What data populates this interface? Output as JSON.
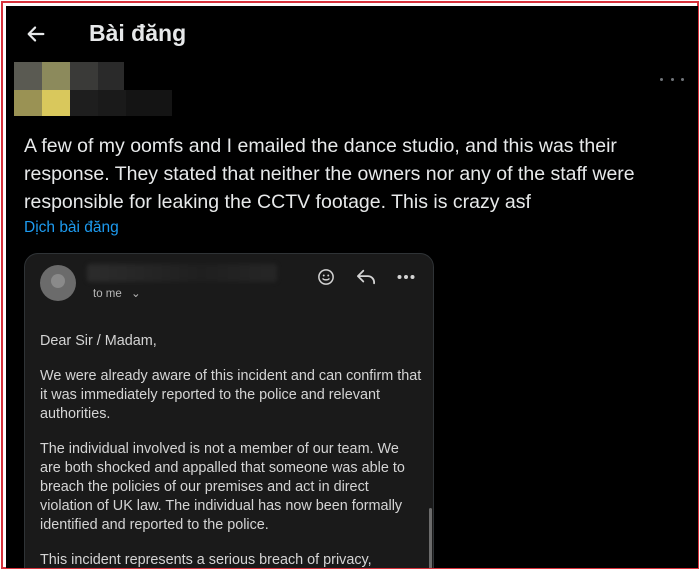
{
  "header": {
    "back_icon": "arrow-left-icon",
    "title": "Bài đăng"
  },
  "post": {
    "avatar_icon": "blurred-profile-avatar",
    "more_icon": "more-horizontal-icon",
    "text": "A few of my oomfs and I emailed the dance studio, and this was their response. They stated that neither the owners nor any of the staff were responsible for leaking the CCTV footage. This is crazy asf",
    "translate_link": "Dịch bài đăng"
  },
  "email_screenshot": {
    "recipient_label": "to me",
    "icons": [
      "smiley-icon",
      "reply-icon",
      "more-horizontal-icon"
    ],
    "body": [
      "Dear Sir / Madam,",
      "We were already aware of this incident and can confirm that it was immediately reported to the police and relevant authorities.",
      "The individual involved is not a member of our team. We are both shocked and appalled that someone was able to breach the policies of our premises and act in direct violation of UK law. The individual has now been formally identified and reported to the police.",
      "This incident represents a serious breach of privacy,"
    ]
  },
  "colors": {
    "background": "#000000",
    "text": "#e7e9ea",
    "link": "#1d9bf0",
    "border_frame": "#d8323c"
  }
}
